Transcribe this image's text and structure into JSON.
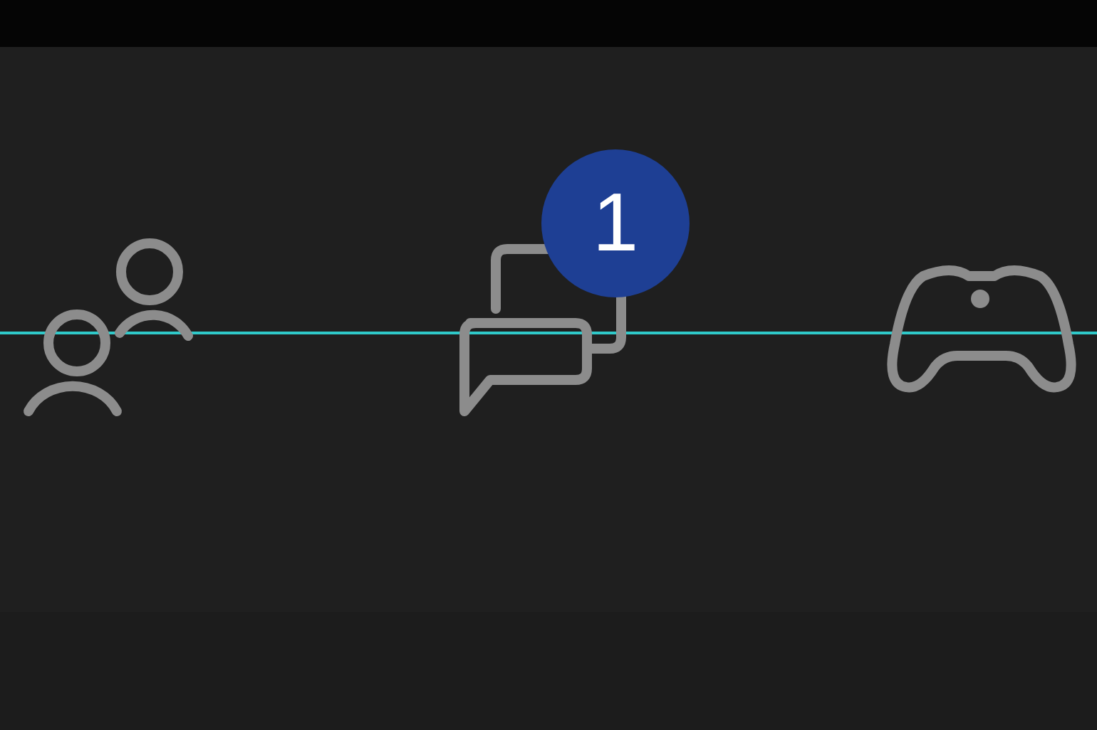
{
  "tabs": [
    {
      "kind": "friends"
    },
    {
      "kind": "chat",
      "badge": "1"
    },
    {
      "kind": "controller"
    }
  ]
}
